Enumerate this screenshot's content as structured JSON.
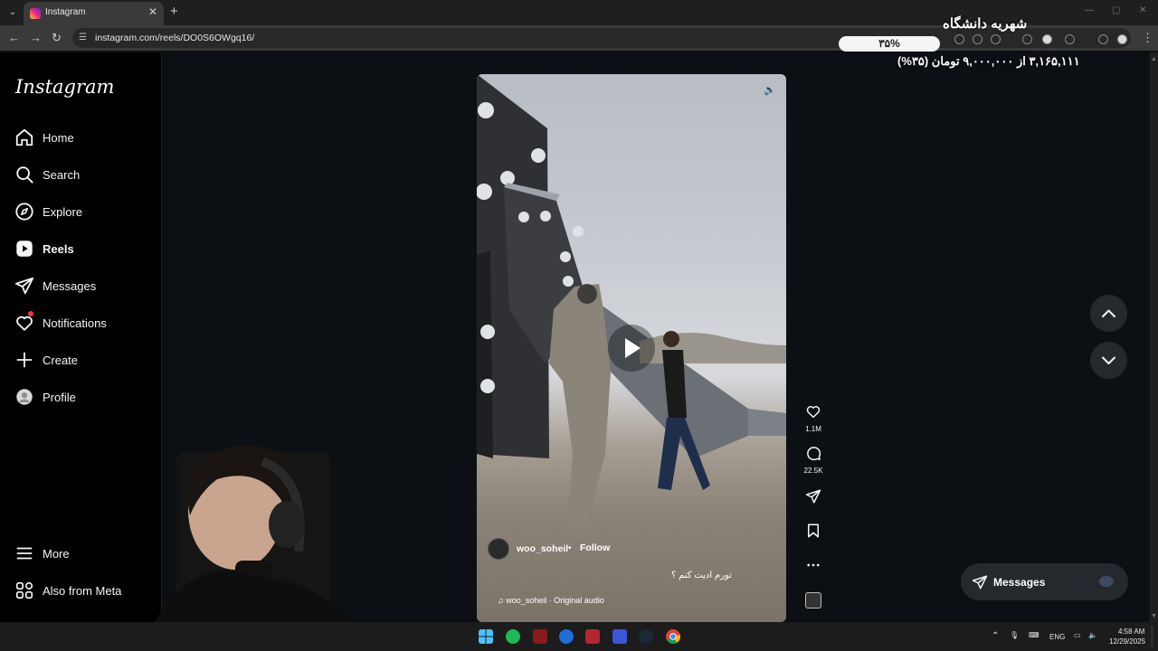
{
  "browser": {
    "tab_title": "Instagram",
    "url": "instagram.com/reels/DO0S6OWgq16/"
  },
  "overlay": {
    "title": "شهریه دانشگاه",
    "progress_text": "۳۵%",
    "progress_fraction": 0.35,
    "amount_text": "۳,۱۶۵,۱۱۱ از ۹,۰۰۰,۰۰۰ تومان (۳۵%)"
  },
  "sidebar": {
    "logo": "Instagram",
    "items": [
      {
        "label": "Home",
        "icon": "home-icon"
      },
      {
        "label": "Search",
        "icon": "search-icon"
      },
      {
        "label": "Explore",
        "icon": "compass-icon"
      },
      {
        "label": "Reels",
        "icon": "reels-icon",
        "active": true
      },
      {
        "label": "Messages",
        "icon": "paper-plane-icon"
      },
      {
        "label": "Notifications",
        "icon": "heart-icon",
        "badge": true
      },
      {
        "label": "Create",
        "icon": "plus-icon"
      },
      {
        "label": "Profile",
        "icon": "profile-icon"
      }
    ],
    "more_label": "More",
    "meta_label": "Also from Meta"
  },
  "reel": {
    "username": "woo_soheil",
    "separator": "•",
    "follow_label": "Follow",
    "caption": "تورم ادیت کنم ؟",
    "audio_text": "woo_soheil · Original audio",
    "likes": "1.1M",
    "comments": "22.5K"
  },
  "messages_pill": {
    "label": "Messages"
  },
  "taskbar": {
    "lang": "ENG",
    "time": "4:58 AM",
    "date": "12/29/2025"
  }
}
